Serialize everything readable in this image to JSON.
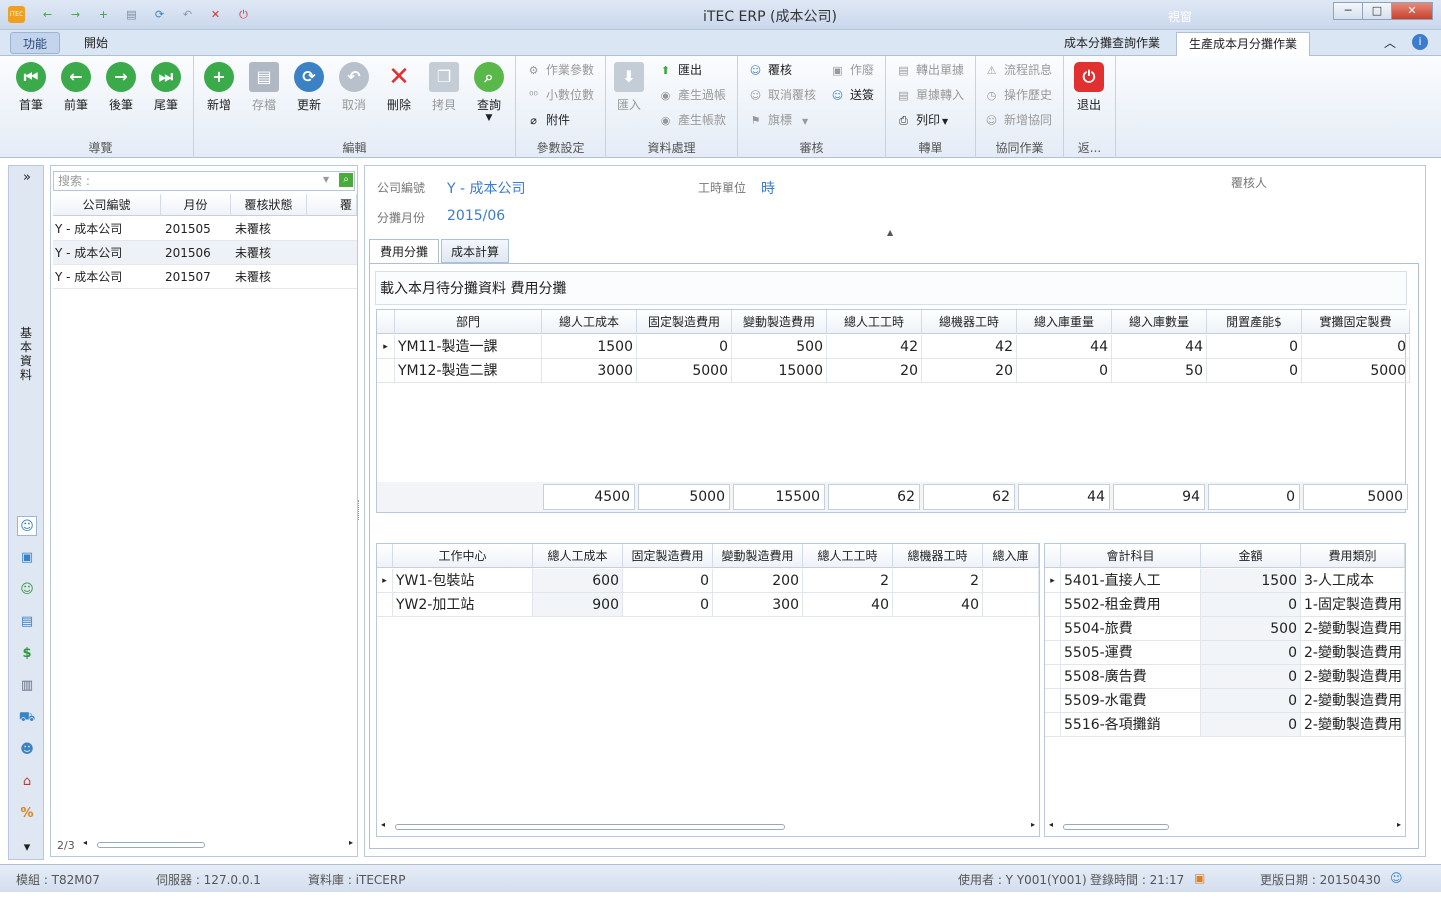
{
  "window": {
    "title": "iTEC ERP (成本公司)",
    "views_label": "視窗",
    "minimize": "─",
    "maximize": "□",
    "close": "✕"
  },
  "quick_access": [
    {
      "name": "app-logo-icon",
      "glyph": "iTEC",
      "color": "#f0a020"
    },
    {
      "name": "back-icon",
      "glyph": "←",
      "color": "#3aa63a"
    },
    {
      "name": "forward-icon",
      "glyph": "→",
      "color": "#3aa63a"
    },
    {
      "name": "add-icon",
      "glyph": "+",
      "color": "#3aa63a"
    },
    {
      "name": "save-icon",
      "glyph": "▤",
      "color": "#7a8aa0"
    },
    {
      "name": "refresh-icon",
      "glyph": "⟳",
      "color": "#3b82c4"
    },
    {
      "name": "undo-icon",
      "glyph": "↶",
      "color": "#8a96a6"
    },
    {
      "name": "delete-icon",
      "glyph": "✕",
      "color": "#e03030"
    },
    {
      "name": "exit-icon",
      "glyph": "⏻",
      "color": "#e03030"
    }
  ],
  "ribbon_tabs": {
    "function": "功能",
    "start": "開始"
  },
  "doc_tabs": {
    "query": "成本分攤查詢作業",
    "monthly": "生產成本月分攤作業"
  },
  "ribbon": {
    "nav": {
      "label": "導覽",
      "first": "首筆",
      "prev": "前筆",
      "next": "後筆",
      "last": "尾筆"
    },
    "edit": {
      "label": "編輯",
      "new": "新增",
      "save": "存檔",
      "update": "更新",
      "cancel": "取消",
      "delete": "刪除",
      "copy": "拷貝",
      "query": "查詢"
    },
    "params": {
      "label": "參數設定",
      "job_params": "作業參數",
      "decimals": "小數位數",
      "attach": "附件"
    },
    "data": {
      "label": "資料處理",
      "import": "匯入",
      "export": "匯出",
      "gen_voucher": "產生過帳",
      "gen_account": "產生帳款"
    },
    "review": {
      "label": "審核",
      "approve": "覆核",
      "cancel_approve": "取消覆核",
      "flag": "旗標",
      "void": "作廢",
      "send": "送簽"
    },
    "transfer": {
      "label": "轉單",
      "transfer_out": "轉出單據",
      "transfer_in": "單據轉入",
      "print": "列印"
    },
    "collab": {
      "label": "協同作業",
      "flow_msg": "流程訊息",
      "history": "操作歷史",
      "add_collab": "新增協同"
    },
    "ret": {
      "label": "返...",
      "exit": "退出"
    }
  },
  "left_strip": {
    "expand": "»",
    "label": "基本資料",
    "down": "▾"
  },
  "list": {
    "search_placeholder": "搜索 :",
    "headers": [
      "公司編號",
      "月份",
      "覆核狀態",
      "覆"
    ],
    "rows": [
      {
        "company": "Y - 成本公司",
        "month": "201505",
        "status": "未覆核"
      },
      {
        "company": "Y - 成本公司",
        "month": "201506",
        "status": "未覆核"
      },
      {
        "company": "Y - 成本公司",
        "month": "201507",
        "status": "未覆核"
      }
    ],
    "pager": "2/3"
  },
  "header": {
    "company_label": "公司編號",
    "company_value": "Y - 成本公司",
    "month_label": "分攤月份",
    "month_value": "2015/06",
    "time_unit_label": "工時單位",
    "time_unit_value": "時",
    "reviewer_label": "覆核人"
  },
  "subtabs": {
    "expense": "費用分攤",
    "cost": "成本計算"
  },
  "section_title": "載入本月待分攤資料  費用分攤",
  "dept_grid": {
    "headers": [
      "部門",
      "總人工成本",
      "固定製造費用",
      "變動製造費用",
      "總人工工時",
      "總機器工時",
      "總入庫重量",
      "總入庫數量",
      "閒置產能$",
      "實攤固定製費"
    ],
    "rows": [
      [
        "YM11-製造一課",
        "1500",
        "0",
        "500",
        "42",
        "42",
        "44",
        "44",
        "0",
        "0"
      ],
      [
        "YM12-製造二課",
        "3000",
        "5000",
        "15000",
        "20",
        "20",
        "0",
        "50",
        "0",
        "5000"
      ]
    ],
    "totals": [
      "4500",
      "5000",
      "15500",
      "62",
      "62",
      "44",
      "94",
      "0",
      "5000"
    ]
  },
  "wc_grid": {
    "headers": [
      "工作中心",
      "總人工成本",
      "固定製造費用",
      "變動製造費用",
      "總人工工時",
      "總機器工時",
      "總入庫"
    ],
    "rows": [
      [
        "YW1-包裝站",
        "600",
        "0",
        "200",
        "2",
        "2",
        ""
      ],
      [
        "YW2-加工站",
        "900",
        "0",
        "300",
        "40",
        "40",
        ""
      ]
    ]
  },
  "acct_grid": {
    "headers": [
      "會計科目",
      "金額",
      "費用類別"
    ],
    "rows": [
      [
        "5401-直接人工",
        "1500",
        "3-人工成本"
      ],
      [
        "5502-租金費用",
        "0",
        "1-固定製造費用"
      ],
      [
        "5504-旅費",
        "500",
        "2-變動製造費用"
      ],
      [
        "5505-運費",
        "0",
        "2-變動製造費用"
      ],
      [
        "5508-廣告費",
        "0",
        "2-變動製造費用"
      ],
      [
        "5509-水電費",
        "0",
        "2-變動製造費用"
      ],
      [
        "5516-各項攤銷",
        "0",
        "2-變動製造費用"
      ]
    ]
  },
  "status": {
    "module": "模組 :   T82M07",
    "server": "伺服器 : 127.0.0.1",
    "db": "資料庫 :   iTECERP",
    "user": "使用者 : Y Y001(Y001)",
    "login": "登錄時間 : 21:17",
    "update": "更版日期 : 20150430"
  }
}
